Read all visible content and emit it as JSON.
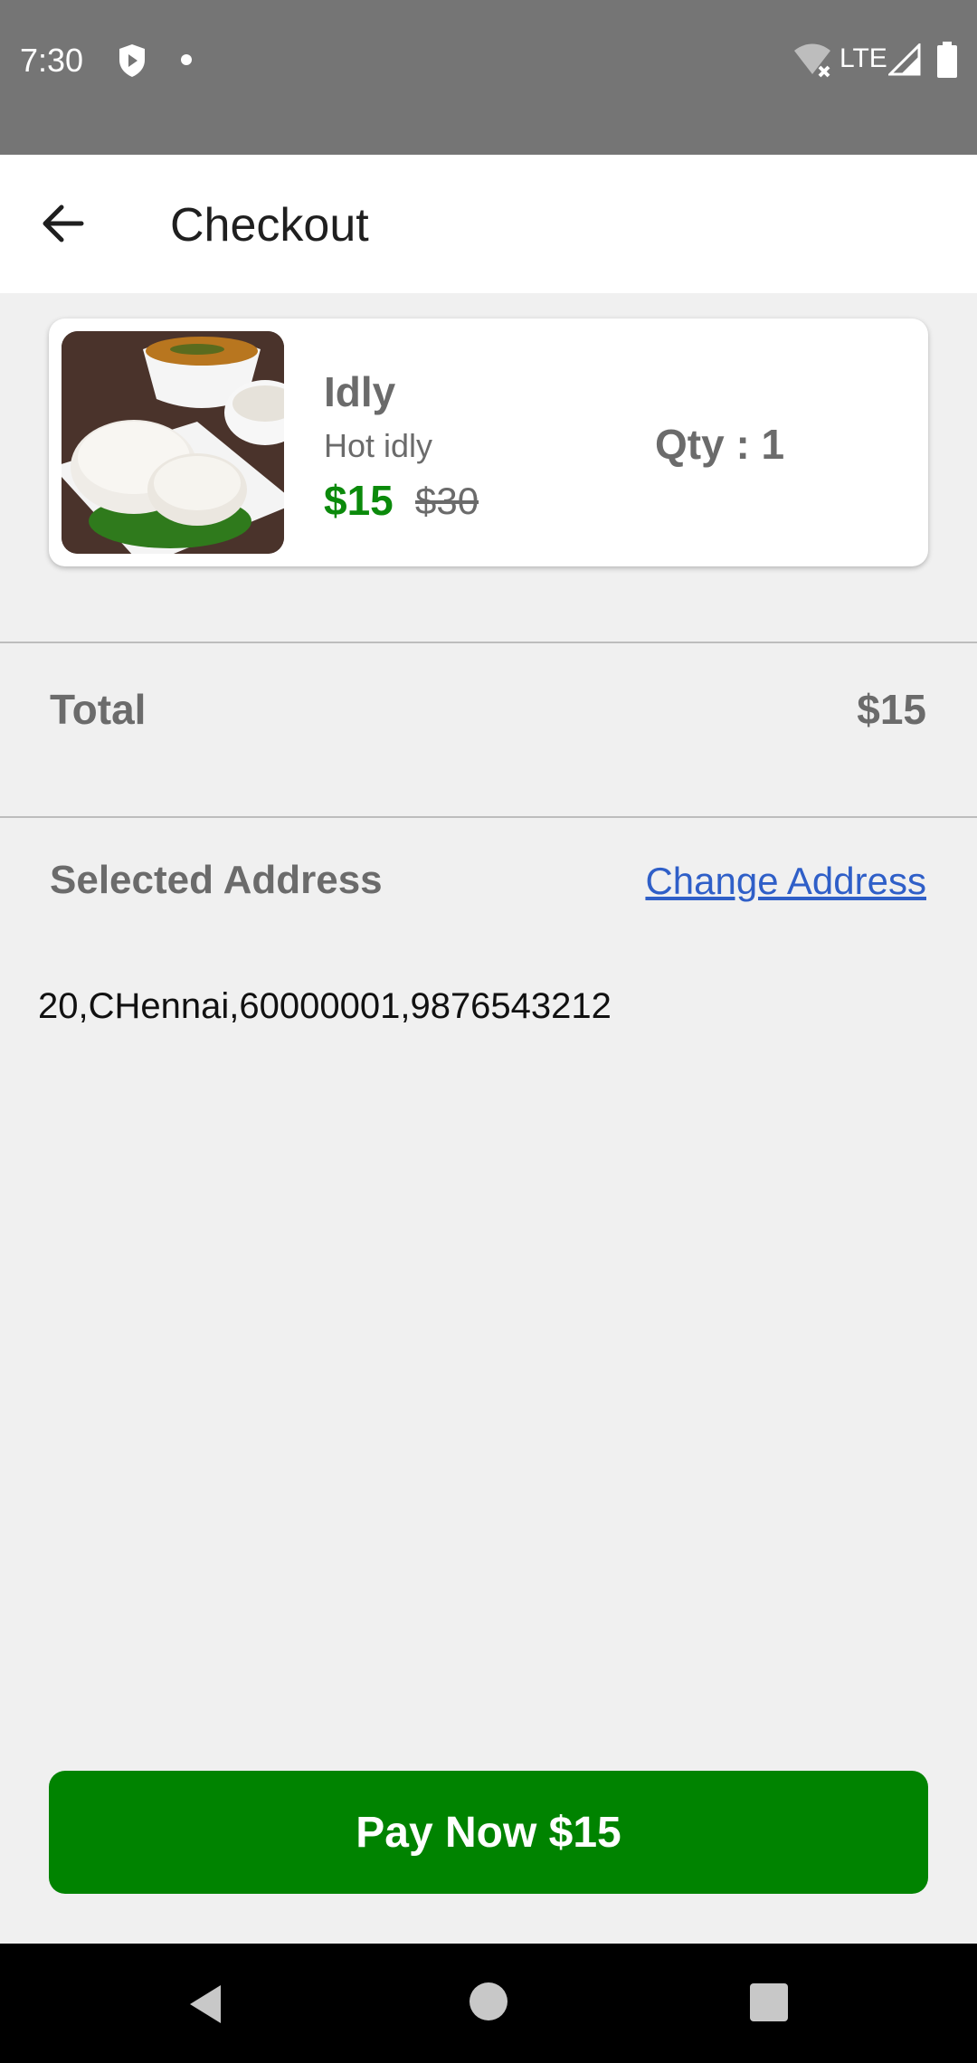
{
  "status_bar": {
    "time": "7:30",
    "network": "LTE",
    "icons": [
      "shield-icon",
      "notification-dot-icon",
      "wifi-off-icon",
      "cell-signal-icon",
      "battery-icon"
    ]
  },
  "app_bar": {
    "title": "Checkout",
    "back_icon": "arrow-back-icon"
  },
  "cart_item": {
    "name": "Idly",
    "description": "Hot idly",
    "price": "$15",
    "original_price": "$30",
    "quantity": "Qty : 1",
    "image": "idly-food-photo"
  },
  "summary": {
    "total_label": "Total",
    "total_value": "$15"
  },
  "address": {
    "label": "Selected Address",
    "change_link": "Change Address",
    "value": "20,CHennai,60000001,9876543212"
  },
  "pay_button": {
    "label": "Pay Now $15"
  },
  "colors": {
    "accent_green": "#008300",
    "price_green": "#0b8a0b",
    "link_blue": "#2f5fc8",
    "status_bar": "#757575"
  }
}
